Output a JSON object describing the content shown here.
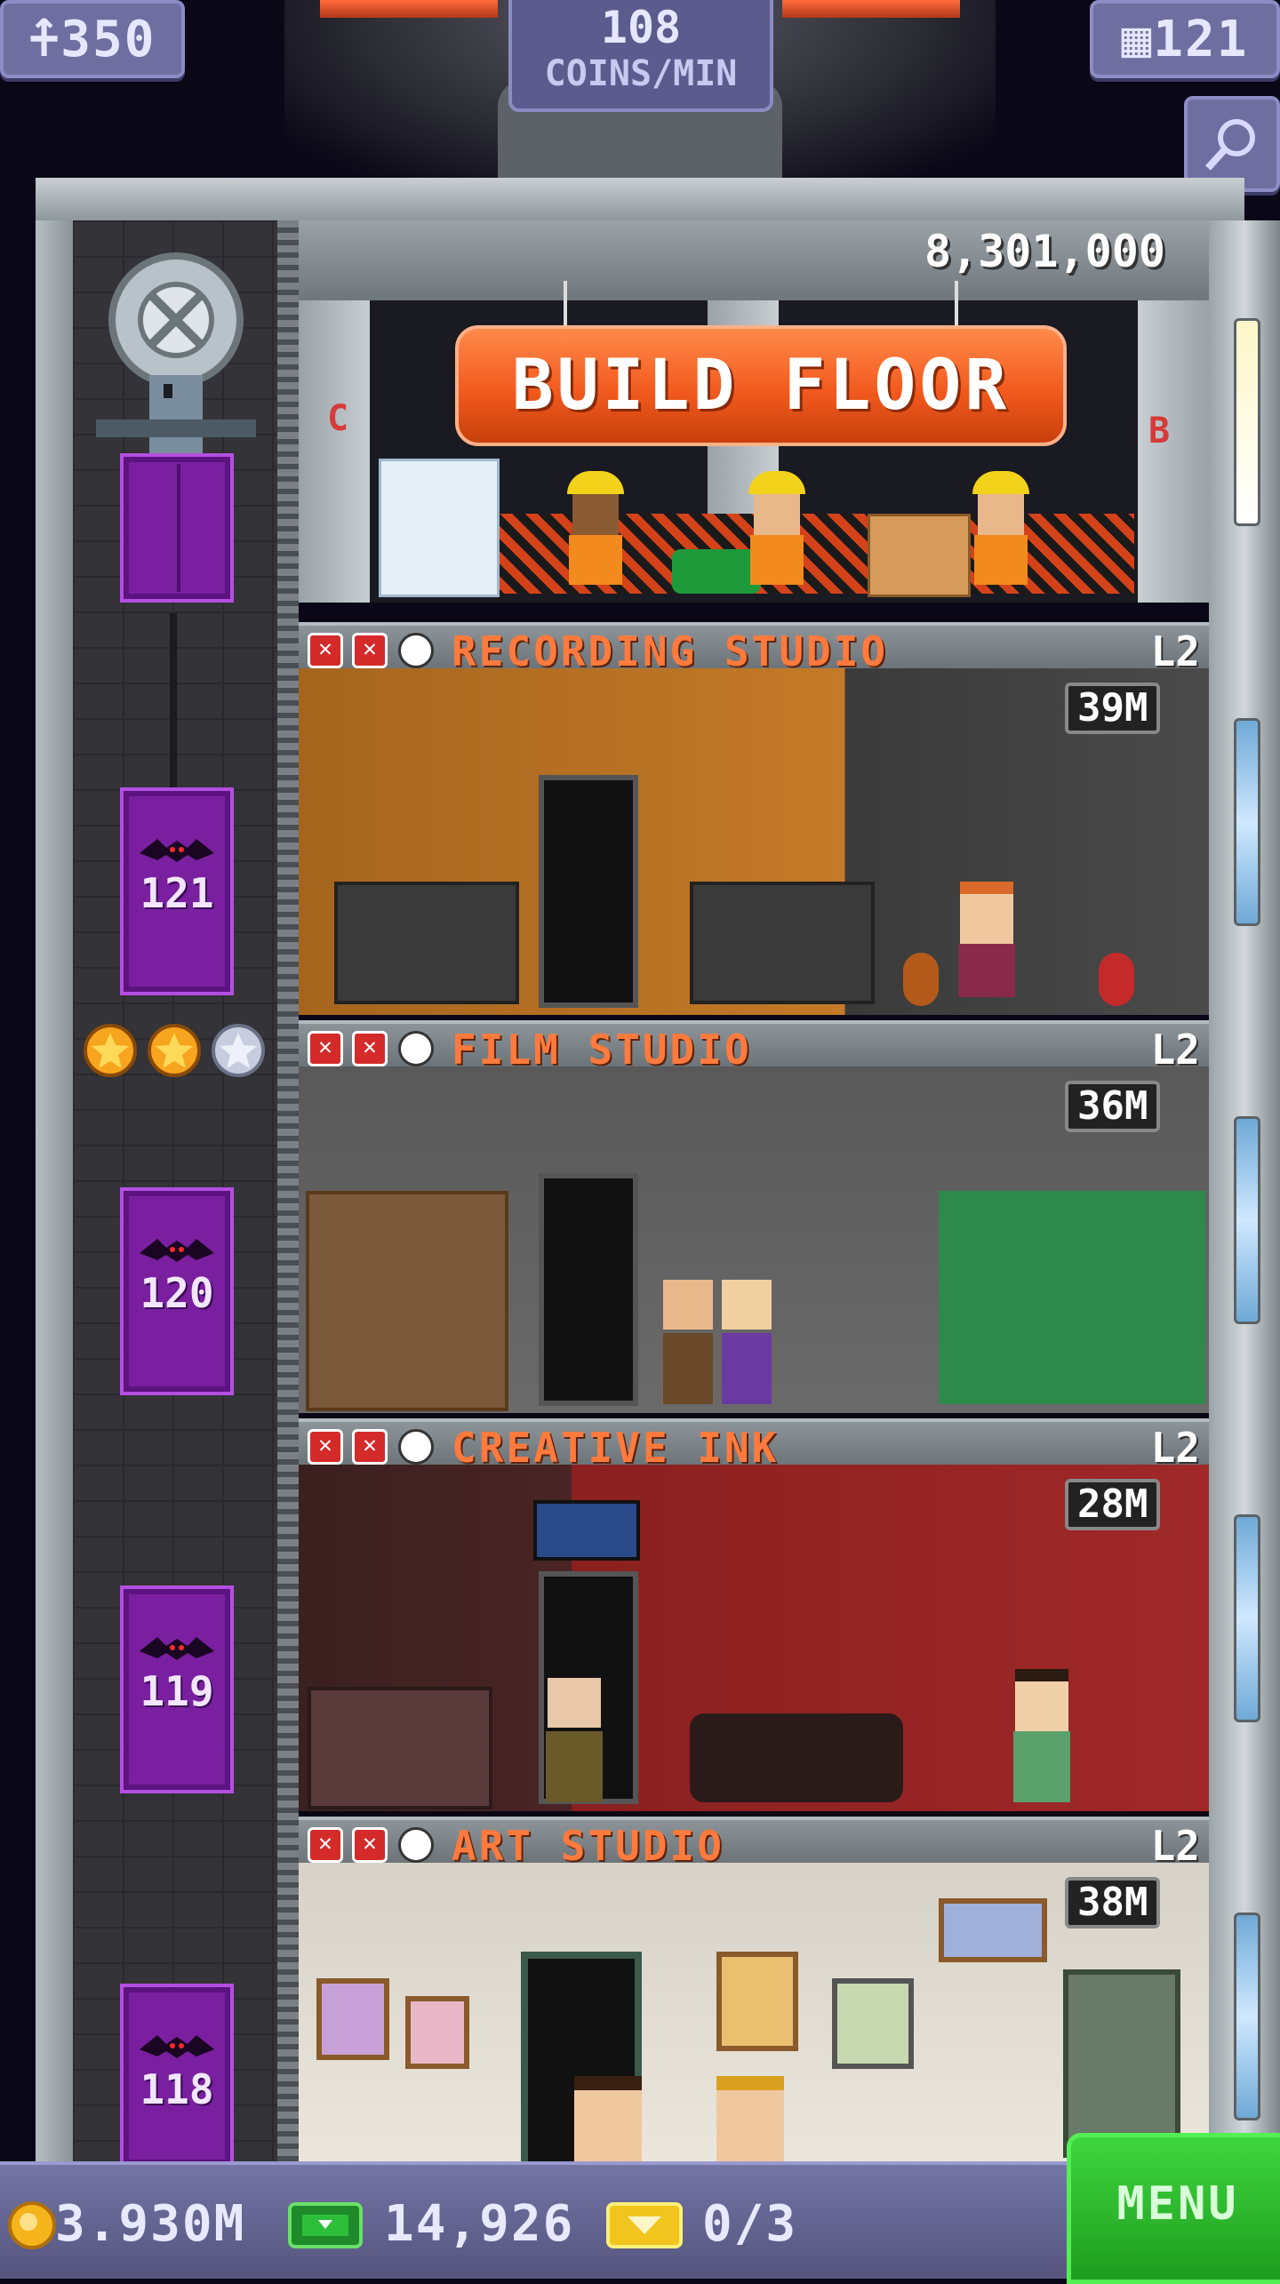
{
  "hud": {
    "population": "350",
    "coins_per_min_value": "108",
    "coins_per_min_label": "COINS/MIN",
    "floors": "121"
  },
  "build": {
    "cost": "8,301,000",
    "button_label": "BUILD FLOOR",
    "left_marker": "C",
    "right_marker": "B"
  },
  "elevator": {
    "cars": [
      "121",
      "120",
      "119",
      "118"
    ],
    "stars_filled": 2,
    "stars_total": 3
  },
  "floors": [
    {
      "name": "RECORDING STUDIO",
      "level": "L2",
      "value": "39M"
    },
    {
      "name": "FILM STUDIO",
      "level": "L2",
      "value": "36M"
    },
    {
      "name": "CREATIVE INK",
      "level": "L2",
      "value": "28M"
    },
    {
      "name": "ART STUDIO",
      "level": "L2",
      "value": "38M"
    }
  ],
  "bottom": {
    "coins": "3.930M",
    "bux": "14,926",
    "tickets": "0/3",
    "menu_label": "MENU"
  },
  "colors": {
    "floor_name": "#ff7a3c",
    "elevator": "#7a1fa0",
    "build_button": "#f25a1e",
    "menu": "#2ebf2e",
    "hud": "#6e6ea0"
  }
}
